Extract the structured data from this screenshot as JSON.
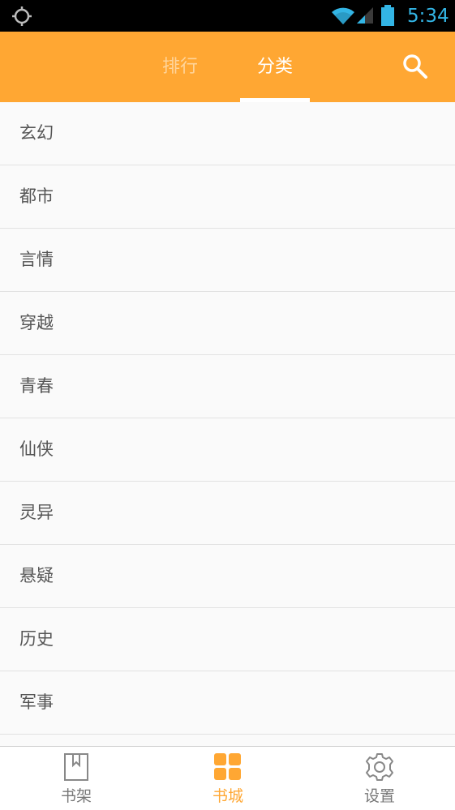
{
  "status_bar": {
    "time": "5:34",
    "left_icon": "gps-icon",
    "icons": [
      "wifi-icon",
      "signal-icon",
      "battery-icon"
    ]
  },
  "header": {
    "tabs": [
      {
        "label": "排行",
        "active": false
      },
      {
        "label": "分类",
        "active": true
      }
    ],
    "search_icon": "search-icon"
  },
  "categories": [
    "玄幻",
    "都市",
    "言情",
    "穿越",
    "青春",
    "仙侠",
    "灵异",
    "悬疑",
    "历史",
    "军事"
  ],
  "bottom_nav": [
    {
      "label": "书架",
      "icon": "bookshelf-icon",
      "active": false
    },
    {
      "label": "书城",
      "icon": "bookstore-grid-icon",
      "active": true
    },
    {
      "label": "设置",
      "icon": "settings-gear-icon",
      "active": false
    }
  ],
  "colors": {
    "accent": "#ffa733",
    "status_time": "#33b5e5",
    "inactive_tab": "#ffd49a"
  }
}
